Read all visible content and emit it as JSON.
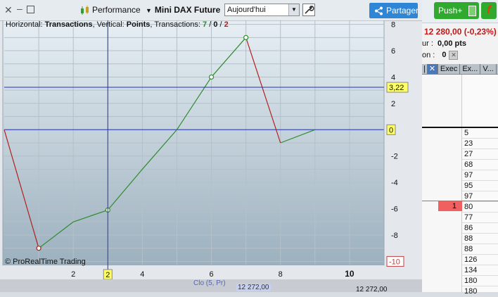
{
  "toolbar": {
    "performance_label": "Performance",
    "instrument_label": "Mini DAX Future",
    "date_value": "Aujourd'hui",
    "share_label": "Partager"
  },
  "right_panel": {
    "push_label": "Push+",
    "f_label": "f",
    "price_text": "12 280,00 (-0,23%)",
    "row1_label": "ur :",
    "row1_value": "0,00 pts",
    "row2_label": "on :",
    "row2_value": "0",
    "columns": [
      "Exec",
      "Ex...",
      "V..."
    ],
    "highlighted_value": "1",
    "numbers": [
      "5",
      "23",
      "27",
      "68",
      "97",
      "95",
      "97",
      "80",
      "77",
      "86",
      "88",
      "88",
      "126",
      "134",
      "180",
      "180"
    ]
  },
  "bottom": {
    "label_left": "Clo (5, Pr)",
    "price_left": "12 272,00",
    "price_right": "12 272,00"
  },
  "chart_data": {
    "type": "line",
    "caption_prefix": "Horizontal: ",
    "caption_x": "Transactions",
    "caption_mid": ", Vertical: ",
    "caption_y": "Points",
    "caption_tx": ", Transactions: ",
    "count_green": "7",
    "count_sep1": " / ",
    "count_zero": "0",
    "count_sep2": " / ",
    "count_red": "2",
    "x": [
      0,
      1,
      2,
      3,
      4,
      5,
      6,
      7,
      8,
      9
    ],
    "y": [
      0,
      -9,
      -7,
      -6.1,
      -3,
      0,
      4,
      7,
      -1,
      0
    ],
    "markers_x": [
      1,
      3,
      6,
      7
    ],
    "xlim": [
      0,
      11
    ],
    "ylim": [
      -10.3,
      8.3
    ],
    "x_ticks": [
      "2",
      "4",
      "6",
      "8",
      "10"
    ],
    "y_ticks": [
      "8",
      "6",
      "4",
      "2",
      "0",
      "-2",
      "-4",
      "-6",
      "-8"
    ],
    "crosshair_x": 3,
    "crosshair_x_label": "2",
    "crosshair_y": 3.22,
    "crosshair_y_label": "3,22",
    "zero_label": "0",
    "min_label": "-10",
    "up_color": "#2e8b2e",
    "down_color": "#b02020",
    "watermark": "© ProRealTime Trading"
  }
}
